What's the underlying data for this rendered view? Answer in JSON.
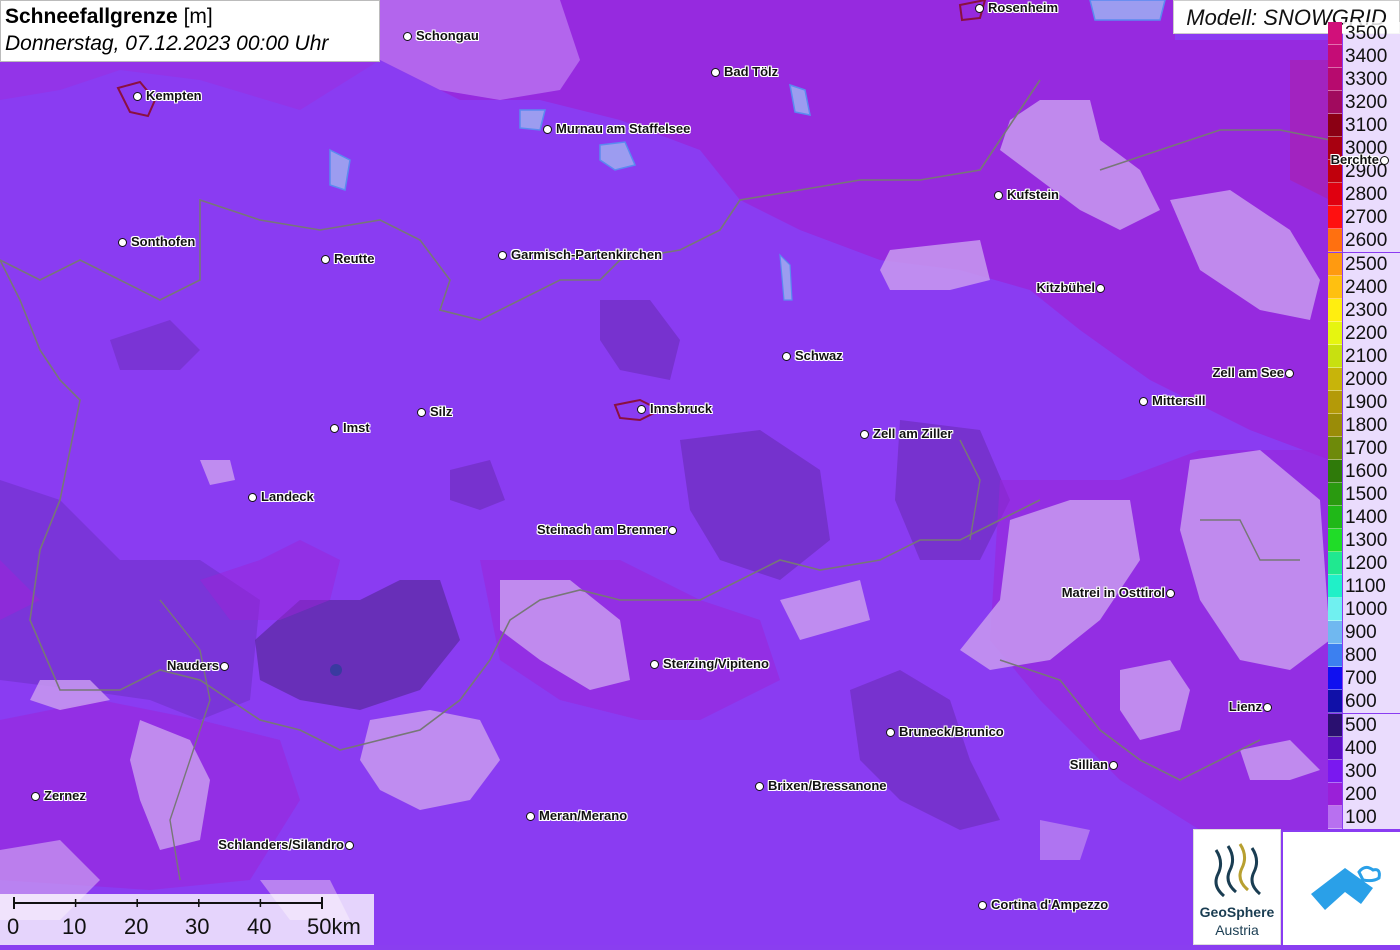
{
  "title": {
    "main": "Schneefallgrenze",
    "unit": "[m]",
    "datetime": "Donnerstag, 07.12.2023 00:00 Uhr"
  },
  "model": "Modell: SNOWGRID",
  "legend": [
    {
      "label": "3500",
      "color": "#d1107a"
    },
    {
      "label": "3400",
      "color": "#c50c76"
    },
    {
      "label": "3300",
      "color": "#b70a6e"
    },
    {
      "label": "3200",
      "color": "#a10a5e"
    },
    {
      "label": "3100",
      "color": "#8b0014"
    },
    {
      "label": "3000",
      "color": "#a80010"
    },
    {
      "label": "2900",
      "color": "#c0000c"
    },
    {
      "label": "2800",
      "color": "#e00010"
    },
    {
      "label": "2700",
      "color": "#ff1010"
    },
    {
      "label": "2600",
      "color": "#ff7010"
    },
    {
      "label": "2500",
      "color": "#ff9a10"
    },
    {
      "label": "2400",
      "color": "#ffc010"
    },
    {
      "label": "2300",
      "color": "#ffee10"
    },
    {
      "label": "2200",
      "color": "#e6f510"
    },
    {
      "label": "2100",
      "color": "#c8e010"
    },
    {
      "label": "2000",
      "color": "#c8b40a"
    },
    {
      "label": "1900",
      "color": "#b49a08"
    },
    {
      "label": "1800",
      "color": "#9a8c08"
    },
    {
      "label": "1700",
      "color": "#6e8a0a"
    },
    {
      "label": "1600",
      "color": "#2f7a0a"
    },
    {
      "label": "1500",
      "color": "#2a9a10"
    },
    {
      "label": "1400",
      "color": "#20b818"
    },
    {
      "label": "1300",
      "color": "#20dc28"
    },
    {
      "label": "1200",
      "color": "#20e890"
    },
    {
      "label": "1100",
      "color": "#20f0c8"
    },
    {
      "label": "1000",
      "color": "#70f0f0"
    },
    {
      "label": "900",
      "color": "#70b8f0"
    },
    {
      "label": "800",
      "color": "#3c80f0"
    },
    {
      "label": "700",
      "color": "#1010f0"
    },
    {
      "label": "600",
      "color": "#1010a8"
    },
    {
      "label": "500",
      "color": "#2a1070"
    },
    {
      "label": "400",
      "color": "#5a10c0"
    },
    {
      "label": "300",
      "color": "#7a18f0"
    },
    {
      "label": "200",
      "color": "#9a20d8"
    },
    {
      "label": "100",
      "color": "#b870f0"
    }
  ],
  "cities": [
    {
      "name": "Rosenheim",
      "side": "right"
    },
    {
      "name": "Schongau",
      "side": "right"
    },
    {
      "name": "Bad Tölz",
      "side": "right"
    },
    {
      "name": "Kempten",
      "side": "right"
    },
    {
      "name": "Murnau am Staffelsee",
      "side": "right"
    },
    {
      "name": "Berchte",
      "side": "left"
    },
    {
      "name": "Kufstein",
      "side": "right"
    },
    {
      "name": "Sonthofen",
      "side": "right"
    },
    {
      "name": "Reutte",
      "side": "right"
    },
    {
      "name": "Garmisch-Partenkirchen",
      "side": "right"
    },
    {
      "name": "Kitzbühel",
      "side": "left"
    },
    {
      "name": "Schwaz",
      "side": "right"
    },
    {
      "name": "Zell am See",
      "side": "left"
    },
    {
      "name": "Mittersill",
      "side": "right"
    },
    {
      "name": "Silz",
      "side": "right"
    },
    {
      "name": "Innsbruck",
      "side": "right"
    },
    {
      "name": "Imst",
      "side": "right"
    },
    {
      "name": "Zell am Ziller",
      "side": "right"
    },
    {
      "name": "Landeck",
      "side": "right"
    },
    {
      "name": "Steinach am Brenner",
      "side": "left"
    },
    {
      "name": "Matrei in Osttirol",
      "side": "left"
    },
    {
      "name": "Nauders",
      "side": "left"
    },
    {
      "name": "Sterzing/Vipiteno",
      "side": "right"
    },
    {
      "name": "Lienz",
      "side": "left"
    },
    {
      "name": "Bruneck/Brunico",
      "side": "right"
    },
    {
      "name": "Sillian",
      "side": "left"
    },
    {
      "name": "Zernez",
      "side": "right"
    },
    {
      "name": "Brixen/Bressanone",
      "side": "right"
    },
    {
      "name": "Meran/Merano",
      "side": "right"
    },
    {
      "name": "Schlanders/Silandro",
      "side": "left"
    },
    {
      "name": "Cortina d'Ampezzo",
      "side": "right"
    }
  ],
  "scale": {
    "labels": [
      "0",
      "10",
      "20",
      "30",
      "40",
      "50km"
    ]
  },
  "logos": {
    "geosphere_line1": "GeoSphere",
    "geosphere_line2": "Austria"
  }
}
